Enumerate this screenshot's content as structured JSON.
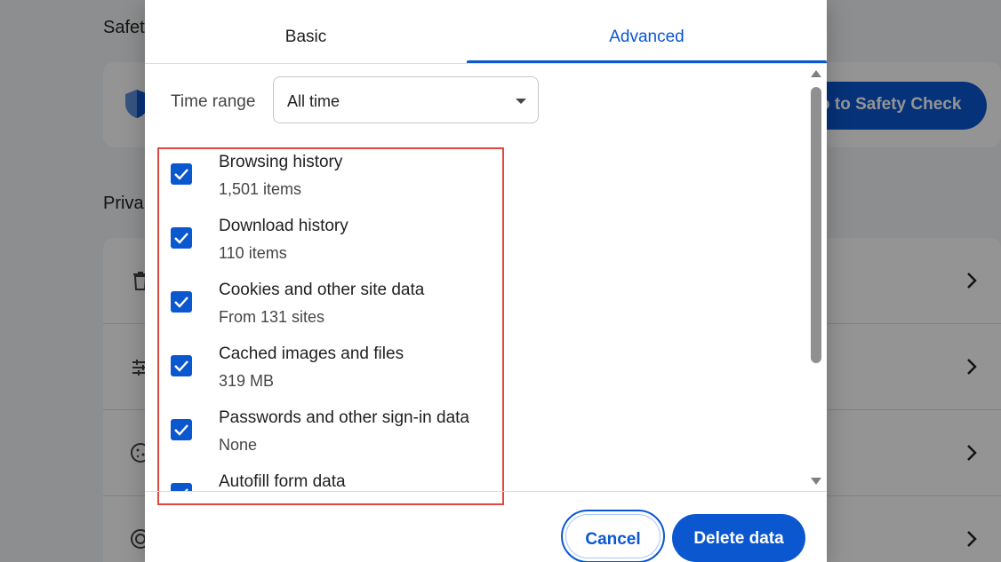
{
  "background": {
    "section_safety": "Safet",
    "safety_button": "o to Safety Check",
    "section_privacy": "Priva"
  },
  "dialog": {
    "tabs": [
      {
        "label": "Basic",
        "active": false
      },
      {
        "label": "Advanced",
        "active": true
      }
    ],
    "time_range": {
      "label": "Time range",
      "value": "All time"
    },
    "items": [
      {
        "title": "Browsing history",
        "subtitle": "1,501 items",
        "checked": true
      },
      {
        "title": "Download history",
        "subtitle": "110 items",
        "checked": true
      },
      {
        "title": "Cookies and other site data",
        "subtitle": "From 131 sites",
        "checked": true
      },
      {
        "title": "Cached images and files",
        "subtitle": "319 MB",
        "checked": true
      },
      {
        "title": "Passwords and other sign-in data",
        "subtitle": "None",
        "checked": true
      },
      {
        "title": "Autofill form data",
        "subtitle": "",
        "checked": true
      }
    ],
    "buttons": {
      "cancel": "Cancel",
      "delete": "Delete data"
    }
  },
  "colors": {
    "accent": "#0b57d0",
    "highlight": "#e2483d",
    "text_primary": "#1f1f1f",
    "text_secondary": "#444746"
  }
}
